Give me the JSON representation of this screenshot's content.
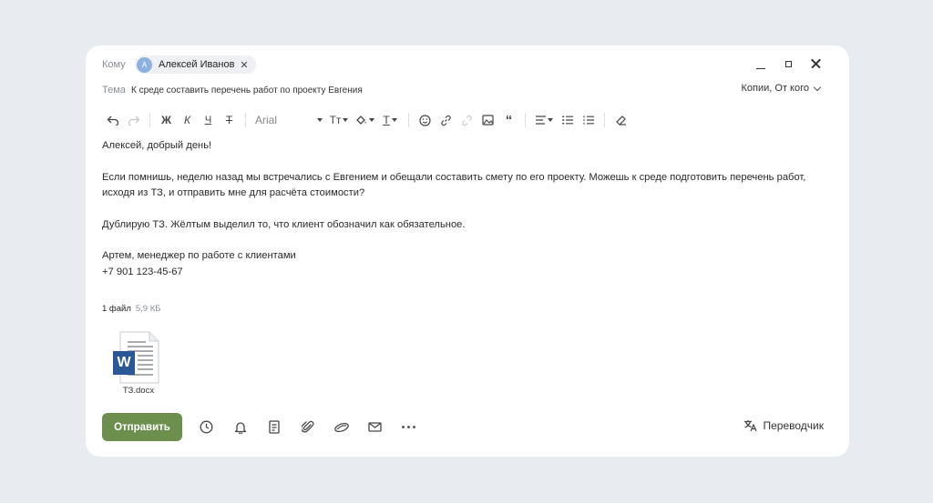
{
  "header": {
    "to_label": "Кому",
    "recipient": {
      "initial": "А",
      "name": "Алексей Иванов"
    },
    "subject_label": "Тема",
    "subject": "К среде составить перечень работ по проекту Евгения",
    "cc_label": "Копии, От кого"
  },
  "toolbar": {
    "bold": "Ж",
    "italic": "К",
    "underline": "Ч",
    "strike": "Т",
    "font": "Arial",
    "text_size": "Тт",
    "text_color": "Т"
  },
  "message": {
    "greeting": "Алексей, добрый день!",
    "paragraph1": "Если помнишь, неделю назад мы встречались с Евгением и обещали составить смету по его проекту. Можешь к среде подготовить перечень работ, исходя из ТЗ, и отправить мне для расчёта стоимости?",
    "paragraph2": "Дублирую ТЗ. Жёлтым выделил то, что клиент обозначил как обязательное.",
    "signature_line1": "Артем, менеджер по работе с клиентами",
    "signature_line2": "+7 901 123-45-67"
  },
  "attachments": {
    "count_label": "1 файл",
    "size_label": "5,9 КБ",
    "files": [
      {
        "name": "ТЗ.docx",
        "icon": "word-doc-icon",
        "letter": "W"
      }
    ]
  },
  "footer": {
    "send_label": "Отправить",
    "translator_label": "Переводчик"
  },
  "colors": {
    "send_button": "#6d8f4e",
    "avatar": "#8fb1e0",
    "word_blue": "#2b5797",
    "background": "#e8ebf0"
  }
}
